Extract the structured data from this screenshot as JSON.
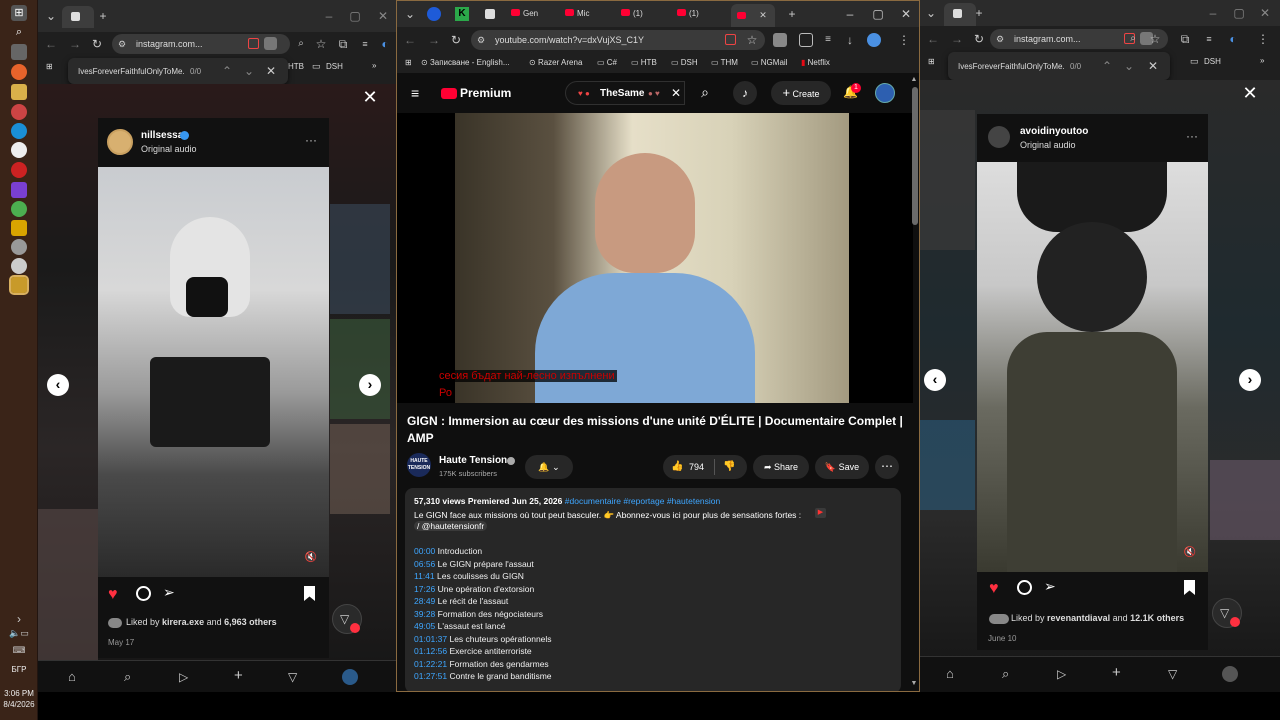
{
  "taskbar": {
    "lang": "БГР",
    "time": "3:06 PM",
    "date": "8/4/2026"
  },
  "left_window": {
    "url": "instagram.com...",
    "find_query": "IvesForeverFaithfulOnlyToMe.",
    "find_count": "0/0",
    "bookmark": "DSH",
    "bookmark2": "HTB",
    "post": {
      "username": "nillsessa",
      "audio": "Original audio",
      "liked_by_user": "kirera.exe",
      "liked_others": "6,963 others",
      "liked_prefix": "Liked by",
      "and": "and",
      "date": "May 17"
    }
  },
  "middle_window": {
    "tabs": [
      "Gen",
      "Mic",
      "(1)",
      "(1)"
    ],
    "url": "youtube.com/watch?v=dxVujXS_C1Y",
    "bookmarks": [
      "Записване - English...",
      "Razer Arena",
      "C#",
      "HTB",
      "DSH",
      "THM",
      "NGMail",
      "Netflix"
    ],
    "header": {
      "brand": "Premium",
      "search_query": "TheSame",
      "create_label": "Create",
      "notif_count": "1"
    },
    "video": {
      "subtitle1": "сесия бъдат най-лесно изпълнени",
      "subtitle2": "Ро"
    },
    "title": "GIGN : Immersion au cœur des missions d'une unité D'ÉLITE | Documentaire Complet | AMP",
    "channel": {
      "name": "Haute Tension",
      "subs": "175K subscribers",
      "avatar_text": "HAUTE TENSION"
    },
    "actions": {
      "likes": "794",
      "share": "Share",
      "save": "Save"
    },
    "description": {
      "meta": "57,310 views  Premiered Jun 25, 2026",
      "tags": "#documentaire #reportage #hautetension",
      "line1": "Le GIGN face aux missions où tout peut basculer. 👉 Abonnez-vous ici pour plus de sensations fortes :",
      "handle": "/ @hautetensionfr",
      "chapters": [
        {
          "time": "00:00",
          "label": "Introduction"
        },
        {
          "time": "06:56",
          "label": "Le GIGN prépare l'assaut"
        },
        {
          "time": "11:41",
          "label": "Les coulisses du GIGN"
        },
        {
          "time": "17:26",
          "label": "Une opération d'extorsion"
        },
        {
          "time": "28:49",
          "label": "Le récit de l'assaut"
        },
        {
          "time": "39:28",
          "label": "Formation des négociateurs"
        },
        {
          "time": "49:05",
          "label": "L'assaut est lancé"
        },
        {
          "time": "01:01:37",
          "label": "Les chuteurs opérationnels"
        },
        {
          "time": "01:12:56",
          "label": "Exercice antiterroriste"
        },
        {
          "time": "01:22:21",
          "label": "Formation des gendarmes"
        },
        {
          "time": "01:27:51",
          "label": "Contre le grand banditisme"
        }
      ]
    }
  },
  "right_window": {
    "url": "instagram.com...",
    "find_query": "IvesForeverFaithfulOnlyToMe.",
    "find_count": "0/0",
    "bookmark": "DSH",
    "post": {
      "username": "avoidinyoutoo",
      "audio": "Original audio",
      "liked_prefix": "Liked by",
      "liked_by_user": "revenantdiaval",
      "and": "and",
      "liked_others": "12.1K others",
      "date": "June 10"
    }
  },
  "colors": {
    "yt_red": "#ff0033",
    "link_blue": "#3ea6ff",
    "ig_like_red": "#ff3040",
    "taskbar": "#3a2418"
  }
}
